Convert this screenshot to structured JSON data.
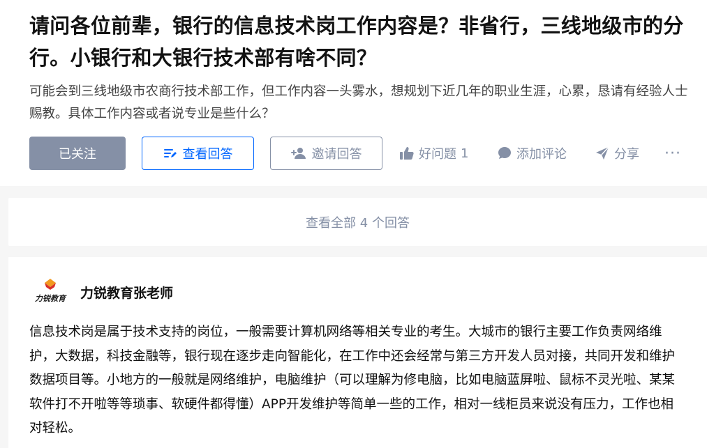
{
  "question": {
    "title": "请问各位前辈，银行的信息技术岗工作内容是？非省行，三线地级市的分行。小银行和大银行技术部有啥不同？",
    "description": "可能会到三线地级市农商行技术部工作，但工作内容一头雾水，想规划下近几年的职业生涯，心累，恳请有经验人士赐教。具体工作内容或者说专业是些什么？",
    "actions": {
      "followed_label": "已关注",
      "view_answers_label": "查看回答",
      "invite_label": "邀请回答",
      "good_question_label": "好问题",
      "good_question_count": "1",
      "comment_label": "添加评论",
      "share_label": "分享",
      "more_label": "···"
    }
  },
  "view_all": {
    "label": "查看全部 4 个回答"
  },
  "answer": {
    "author_name": "力锐教育张老师",
    "avatar_text": "力锐教育",
    "content": "信息技术岗是属于技术支持的岗位，一般需要计算机网络等相关专业的考生。大城市的银行主要工作负责网络维护，大数据，科技金融等，银行现在逐步走向智能化，在工作中还会经常与第三方开发人员对接，共同开发和维护数据项目等。小地方的一般就是网络维护，电脑维护（可以理解为修电脑，比如电脑蓝屏啦、鼠标不灵光啦、某某软件打不开啦等等琐事、软硬件都得懂）APP开发维护等简单一些的工作，相对一线柜员来说没有压力，工作也相对轻松。"
  },
  "colors": {
    "primary": "#0066ff",
    "muted": "#8590a6",
    "followed_bg": "#8590a6",
    "logo_red": "#d8312a",
    "logo_orange": "#f29a1f"
  }
}
